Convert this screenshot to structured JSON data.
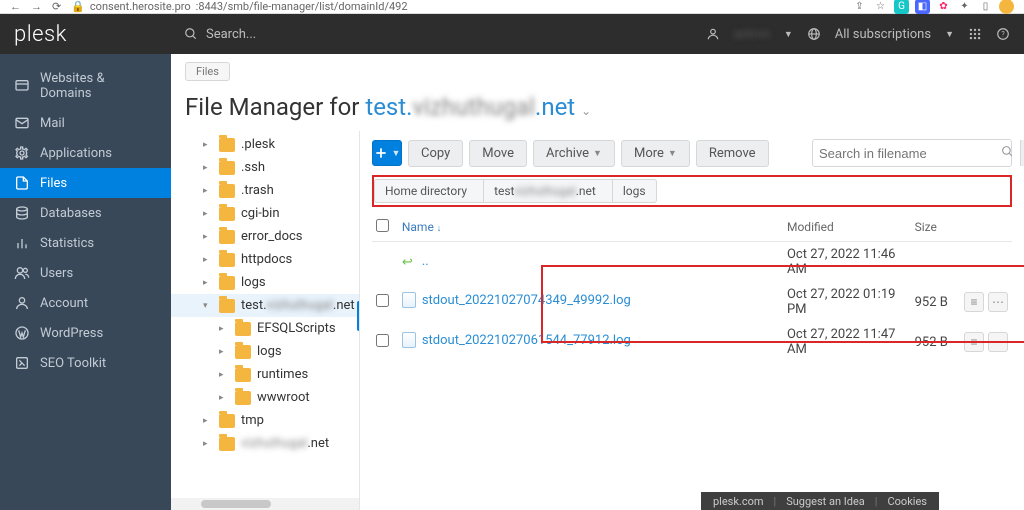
{
  "browser": {
    "url_host": "consent.herosite.pro",
    "url_path": ":8443/smb/file-manager/list/domainId/492"
  },
  "brand": "plesk",
  "topbar": {
    "search_placeholder": "Search...",
    "username": "admin",
    "subscriptions": "All subscriptions"
  },
  "nav": [
    {
      "key": "websites",
      "label": "Websites & Domains"
    },
    {
      "key": "mail",
      "label": "Mail"
    },
    {
      "key": "applications",
      "label": "Applications"
    },
    {
      "key": "files",
      "label": "Files",
      "active": true
    },
    {
      "key": "databases",
      "label": "Databases"
    },
    {
      "key": "statistics",
      "label": "Statistics"
    },
    {
      "key": "users",
      "label": "Users"
    },
    {
      "key": "account",
      "label": "Account"
    },
    {
      "key": "wordpress",
      "label": "WordPress"
    },
    {
      "key": "seo",
      "label": "SEO Toolkit"
    }
  ],
  "crumb_chip": "Files",
  "title_prefix": "File Manager for ",
  "title_domain_a": "test.",
  "title_domain_b": ".net",
  "tree": [
    {
      "label": ".plesk",
      "level": 2,
      "collapsed": true
    },
    {
      "label": ".ssh",
      "level": 2,
      "collapsed": true
    },
    {
      "label": ".trash",
      "level": 2,
      "collapsed": true
    },
    {
      "label": "cgi-bin",
      "level": 2,
      "collapsed": true
    },
    {
      "label": "error_docs",
      "level": 2,
      "collapsed": true
    },
    {
      "label": "httpdocs",
      "level": 2,
      "collapsed": true
    },
    {
      "label": "logs",
      "level": 2,
      "collapsed": true
    },
    {
      "label": "test.",
      "suffix": ".net",
      "level": 2,
      "expanded": true,
      "selected": true
    },
    {
      "label": "EFSQLScripts",
      "level": 3,
      "collapsed": true
    },
    {
      "label": "logs",
      "level": 3,
      "collapsed": true
    },
    {
      "label": "runtimes",
      "level": 3,
      "collapsed": true
    },
    {
      "label": "wwwroot",
      "level": 3,
      "collapsed": true
    },
    {
      "label": "tmp",
      "level": 2,
      "collapsed": true
    },
    {
      "label": "",
      "suffix": ".net",
      "level": 2,
      "collapsed": true
    }
  ],
  "toolbar": {
    "copy": "Copy",
    "move": "Move",
    "archive": "Archive",
    "more": "More",
    "remove": "Remove",
    "search_placeholder": "Search in filename"
  },
  "breadcrumb": [
    {
      "label": "Home directory"
    },
    {
      "label": "test",
      "blurred_suffix": ".net"
    },
    {
      "label": "logs"
    }
  ],
  "columns": {
    "name": "Name",
    "modified": "Modified",
    "size": "Size"
  },
  "rows": [
    {
      "type": "up",
      "name": "..",
      "modified": "Oct 27, 2022 11:46 AM",
      "size": ""
    },
    {
      "type": "file",
      "name": "stdout_20221027074349_49992.log",
      "modified": "Oct 27, 2022 01:19 PM",
      "size": "952 B"
    },
    {
      "type": "file",
      "name": "stdout_20221027061544_77912.log",
      "modified": "Oct 27, 2022 11:47 AM",
      "size": "952 B"
    }
  ],
  "footer": {
    "a": "plesk.com",
    "b": "Suggest an Idea",
    "c": "Cookies"
  }
}
